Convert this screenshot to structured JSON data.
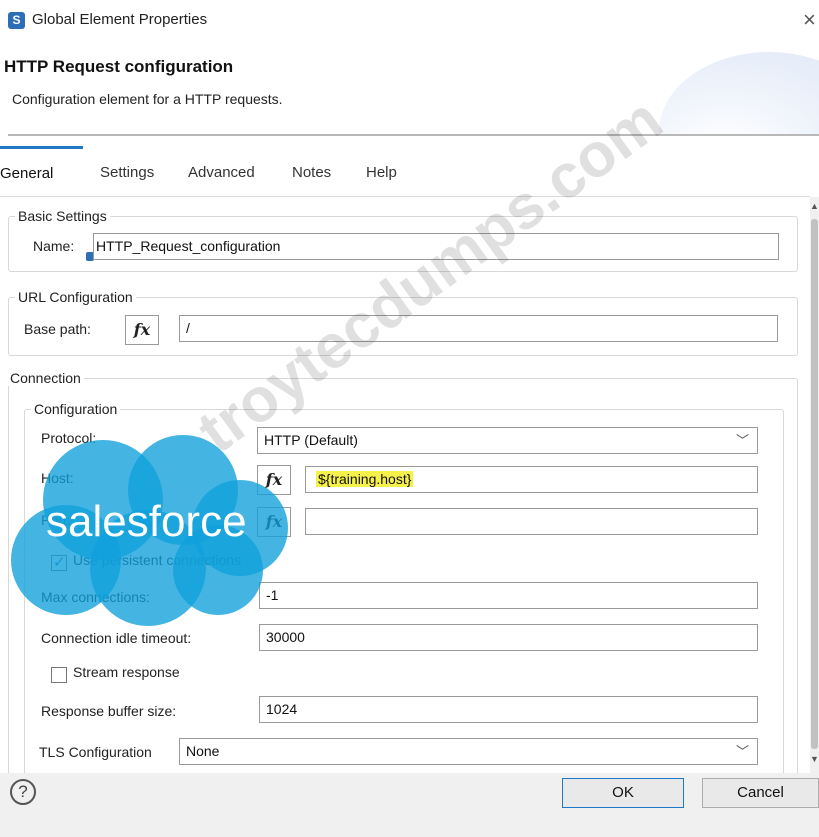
{
  "window": {
    "title": "Global Element Properties",
    "app_icon": "S",
    "close_glyph": "×"
  },
  "header": {
    "title": "HTTP Request configuration",
    "description": "Configuration element for a HTTP requests."
  },
  "tabs": [
    {
      "label": "General",
      "active": true
    },
    {
      "label": "Settings",
      "active": false
    },
    {
      "label": "Advanced",
      "active": false
    },
    {
      "label": "Notes",
      "active": false
    },
    {
      "label": "Help",
      "active": false
    }
  ],
  "basic_settings": {
    "legend": "Basic Settings",
    "name_label": "Name:",
    "name_value": "HTTP_Request_configuration"
  },
  "url_configuration": {
    "legend": "URL Configuration",
    "base_path_label": "Base path:",
    "base_path_value": "/"
  },
  "connection": {
    "legend": "Connection",
    "configuration_legend": "Configuration",
    "protocol_label": "Protocol:",
    "protocol_value": "HTTP (Default)",
    "host_label": "Host:",
    "host_value": "${training.host}",
    "port_label": "Port:",
    "port_value": "",
    "persistent_label": "Use persistent connections",
    "persistent_checked": true,
    "max_connections_label": "Max connections:",
    "max_connections_value": "-1",
    "idle_timeout_label": "Connection idle timeout:",
    "idle_timeout_value": "30000",
    "stream_response_label": "Stream response",
    "stream_response_checked": false,
    "buffer_size_label": "Response buffer size:",
    "buffer_size_value": "1024",
    "tls_label": "TLS Configuration",
    "tls_value": "None"
  },
  "fx_glyph": "fx",
  "select_arrow": "﹀",
  "watermark": {
    "logo_text": "salesforce",
    "site_text": "troytecdumps.com",
    "logo_color": "#0fa0db"
  },
  "footer": {
    "help_glyph": "?",
    "ok_label": "OK",
    "cancel_label": "Cancel"
  },
  "colors": {
    "accent": "#1e78c8",
    "highlight": "#f5f04a"
  }
}
